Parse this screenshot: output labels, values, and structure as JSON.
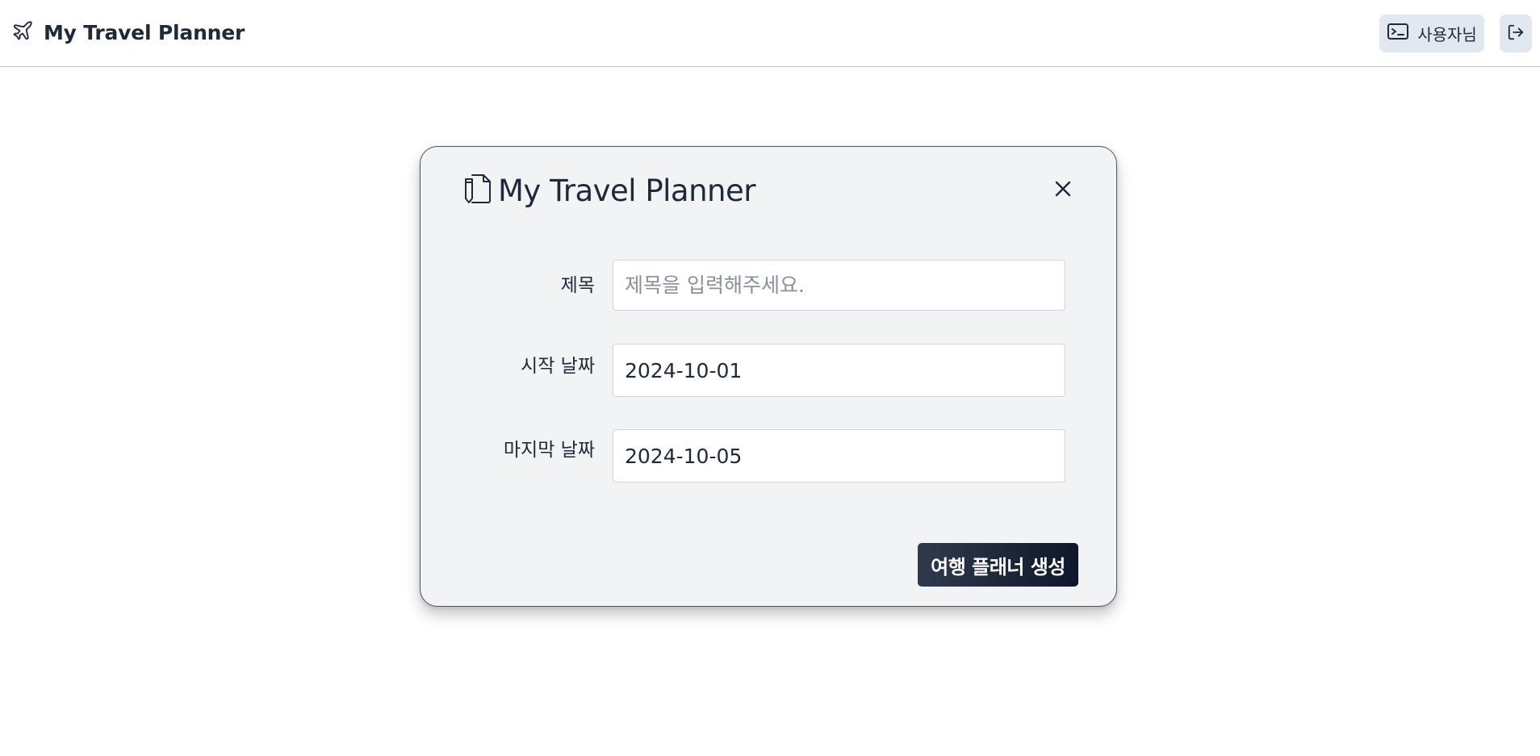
{
  "header": {
    "brand_icon": "airplane-icon",
    "title": "My Travel Planner",
    "user_button": {
      "icon": "user-card-icon",
      "label": "사용자님"
    },
    "logout_button": {
      "icon": "logout-icon"
    }
  },
  "modal": {
    "icon": "document-pen-icon",
    "title": "My Travel Planner",
    "close_icon": "close-icon",
    "fields": {
      "title": {
        "label": "제목",
        "value": "",
        "placeholder": "제목을 입력해주세요."
      },
      "start_date": {
        "label": "시작 날짜",
        "value": "2024-10-01"
      },
      "end_date": {
        "label": "마지막 날짜",
        "value": "2024-10-05"
      }
    },
    "submit_label": "여행 플래너 생성"
  },
  "colors": {
    "button_bg": "#e2e8f0",
    "modal_bg": "#f1f3f5",
    "primary_dark": "#0f172a",
    "text": "#1f2937"
  }
}
